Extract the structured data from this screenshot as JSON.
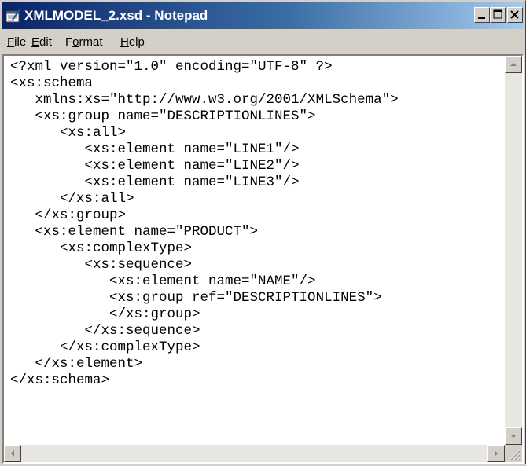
{
  "window": {
    "title": "XMLMODEL_2.xsd - Notepad",
    "icon": "notepad-icon"
  },
  "menu": [
    {
      "accel": "F",
      "rest": "ile"
    },
    {
      "accel": "E",
      "rest": "dit"
    },
    {
      "pre": "F",
      "accel": "o",
      "rest": "rmat"
    },
    {
      "accel": "H",
      "rest": "elp"
    }
  ],
  "editor": {
    "text": "<?xml version=\"1.0\" encoding=\"UTF-8\" ?>\n<xs:schema\n   xmlns:xs=\"http://www.w3.org/2001/XMLSchema\">\n   <xs:group name=\"DESCRIPTIONLINES\">\n      <xs:all>\n         <xs:element name=\"LINE1\"/>\n         <xs:element name=\"LINE2\"/>\n         <xs:element name=\"LINE3\"/>\n      </xs:all>\n   </xs:group>\n   <xs:element name=\"PRODUCT\">\n      <xs:complexType>\n         <xs:sequence>\n            <xs:element name=\"NAME\"/>\n            <xs:group ref=\"DESCRIPTIONLINES\">\n            </xs:group>\n         </xs:sequence>\n      </xs:complexType>\n   </xs:element>\n</xs:schema>"
  },
  "colors": {
    "titlebar_start": "#0a246a",
    "titlebar_end": "#a6caf0",
    "chrome": "#d4d0c8"
  }
}
